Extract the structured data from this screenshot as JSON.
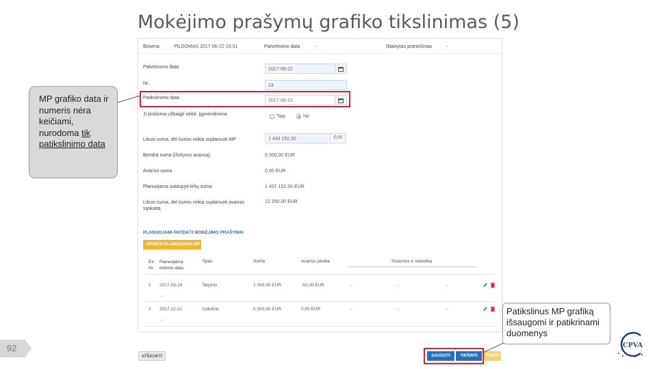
{
  "slide": {
    "title": "Mokėjimo prašymų grafiko tikslinimas (5)",
    "page_number": "92"
  },
  "status_bar": {
    "status_label": "Būsena",
    "status_value": "PILDOMAS",
    "status_date": "2017-06-22 16:01",
    "approval_date_label": "Patvirtinimo data",
    "approval_date_value": "-",
    "returned_label": "Ištaisytas pranešimas",
    "returned_value": "-"
  },
  "form": {
    "approval_date": {
      "label": "Patvirtinimo data",
      "value": "2017-06-22"
    },
    "number": {
      "label": "Nr.",
      "value": "13"
    },
    "clarification_date": {
      "label": "Patikslinimo data",
      "value": "2017-06-23"
    },
    "completion_question": {
      "label": "Ji prašoma užbaigti veikli, įgyvendinima",
      "option_yes": "Taip",
      "option_no": "Ne",
      "selected": "Ne"
    },
    "total_remaining": {
      "label": "Likusi suma, dėl kurios reikia suplanuoti MP",
      "value": "1 443 152,55",
      "unit": "EUR"
    },
    "total_sum": {
      "label": "Bendra suma (išskyrus avansą)",
      "value": "6 000,00 EUR"
    },
    "advance_sum": {
      "label": "Avanso suma",
      "value": "0,00 EUR"
    },
    "planned_sum": {
      "label": "Planuojama sutaupyti lėšų suma",
      "value": "1 437 152,55 EUR"
    },
    "remaining_advance": {
      "label": "Likusi suma, dėl kurios reikia suplanuoti avanso sąskaitą",
      "value": "12 250,00 EUR"
    }
  },
  "planned_requests": {
    "section_title": "PLANUOJAMI PATEIKTI MOKĖJIMO PRAŠYMAI",
    "add_button": "PRIDĖTI PLANUOJAMĄ MP",
    "columns": [
      "Eil. Nr.",
      "Planuojama teikimo data",
      "Tipas",
      "Suma",
      "Avanso įskaita",
      "",
      "Sistemos ir statistika",
      ""
    ],
    "rows": [
      {
        "no": "1",
        "date": "2017-03-24",
        "type": "Tarpinis",
        "sum": "1 000,00 EUR",
        "advance": "-50,00 EUR",
        "c1": "-",
        "c2": "-",
        "c3": "-",
        "sub": "-"
      },
      {
        "no": "2",
        "date": "2017-12-21",
        "type": "Galutinis",
        "sum": "5 000,00 EUR",
        "advance": "0,00 EUR",
        "c1": "-",
        "c2": "-",
        "c3": "-",
        "sub": "-"
      }
    ]
  },
  "bottom_buttons": {
    "cancel": "ATŠAUKTI",
    "save": "SAUGOTI",
    "check": "TIKRINTI",
    "submit": "TEIKTI"
  },
  "callouts": {
    "left_prefix": "MP grafiko data ir numeris nėra keičiami, nurodoma ",
    "left_underlined": "tik patikslinimo data",
    "right": "Patikslinus MP grafiką išsaugomi ir patikrinami duomenys"
  },
  "logo": {
    "text": "CPVA"
  },
  "colors": {
    "highlight": "#e0202a",
    "accent_orange": "#f6b72e",
    "button_blue": "#2a6ebb",
    "section_blue": "#2b6cb0"
  }
}
